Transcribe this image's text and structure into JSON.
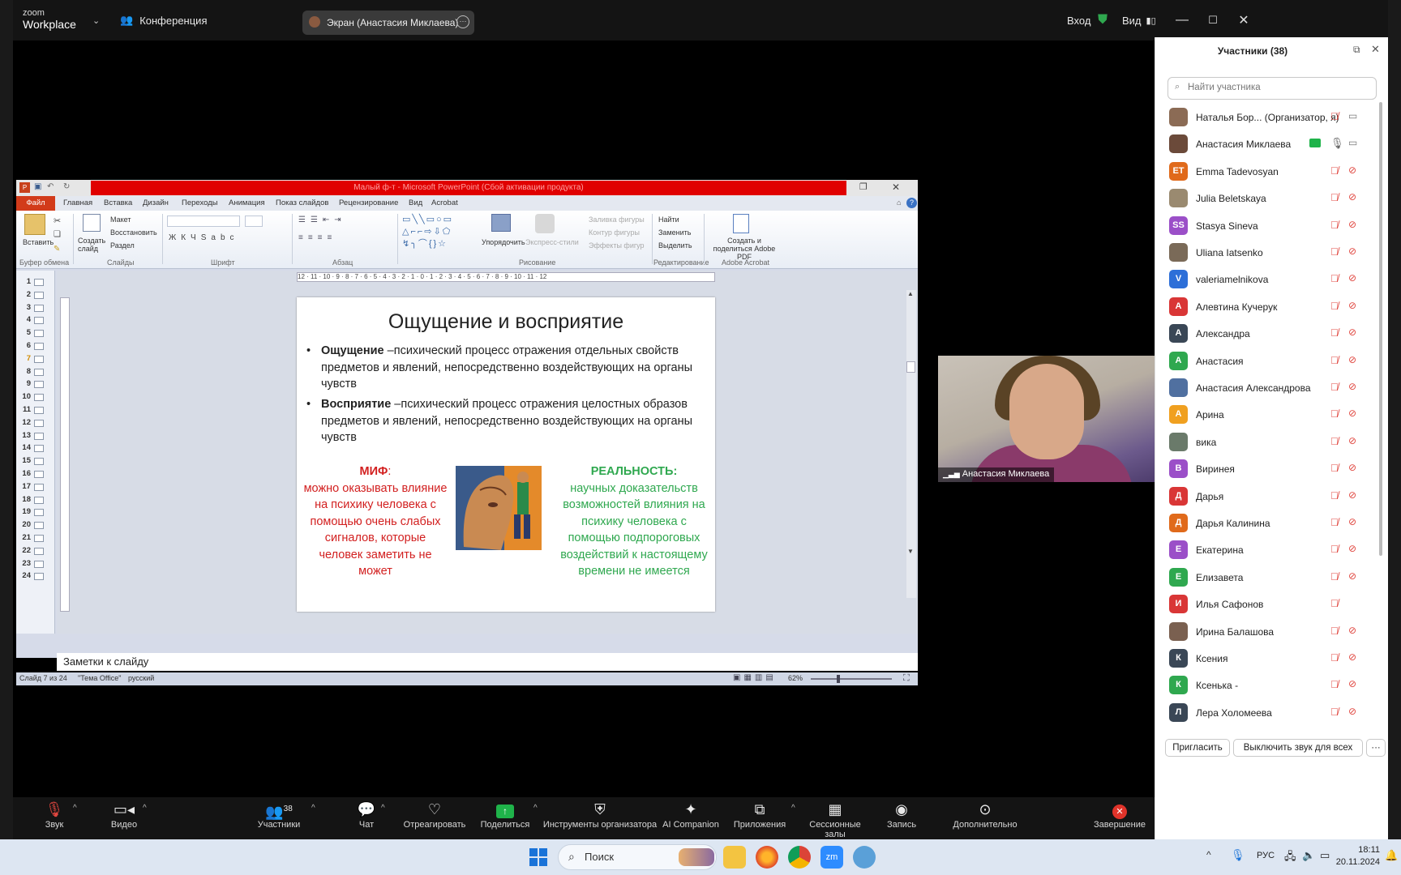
{
  "zoom": {
    "logo_line1": "zoom",
    "logo_line2": "Workplace",
    "conference_label": "Конференция",
    "share_label": "Экран (Анастасия Миклаева)",
    "signin": "Вход",
    "view": "Вид"
  },
  "ppt": {
    "window_title": "Малый ф-т - Microsoft PowerPoint (Сбой активации продукта)",
    "tabs": [
      "Файл",
      "Главная",
      "Вставка",
      "Дизайн",
      "Переходы",
      "Анимация",
      "Показ слайдов",
      "Рецензирование",
      "Вид",
      "Acrobat"
    ],
    "ribbon": {
      "paste": "Вставить",
      "new_slide": "Создать слайд",
      "layout": "Макет",
      "reset": "Восстановить",
      "section": "Раздел",
      "arrange": "Упорядочить",
      "quick_styles": "Экспресс-стили",
      "fill": "Заливка фигуры",
      "outline": "Контур фигуры",
      "effects": "Эффекты фигур",
      "find": "Найти",
      "replace": "Заменить",
      "select": "Выделить",
      "acrobat": "Создать и поделиться Adobe PDF",
      "groups": [
        "Буфер обмена",
        "Слайды",
        "Шрифт",
        "Абзац",
        "Рисование",
        "Редактирование",
        "Adobe Acrobat"
      ]
    },
    "ruler": "12 · 11 · 10 · 9 · 8 · 7 · 6 · 5 · 4 · 3 · 2 · 1 · 0 · 1 · 2 · 3 · 4 · 5 · 6 · 7 · 8 · 9 · 10 · 11 · 12",
    "slide_numbers": [
      "1",
      "2",
      "3",
      "4",
      "5",
      "6",
      "7",
      "8",
      "9",
      "10",
      "11",
      "12",
      "13",
      "14",
      "15",
      "16",
      "17",
      "18",
      "19",
      "20",
      "21",
      "22",
      "23",
      "24"
    ],
    "slide": {
      "title": "Ощущение и восприятие",
      "b1_term": "Ощущение",
      "b1_text": " –психический процесс отражения отдельных свойств предметов и явлений, непосредственно воздействующих на органы чувств",
      "b2_term": "Восприятие",
      "b2_text": " –психический процесс отражения целостных образов предметов и явлений, непосредственно воздействующих на органы чувств",
      "myth_head": "МИФ",
      "myth_colon": ":",
      "myth_text": "можно оказывать влияние на психику человека с помощью очень слабых сигналов, которые человек заметить не может",
      "real_head": "РЕАЛЬНОСТЬ:",
      "real_text": "научных доказательств возможностей влияния на психику человека с помощью подпороговых воздействий к настоящему времени не имеется"
    },
    "notes": "Заметки к слайду",
    "status": {
      "slide": "Слайд 7 из 24",
      "theme": "\"Тема Office\"",
      "lang": "русский",
      "zoom": "62%"
    }
  },
  "video": {
    "name": "Анастасия Миклаева"
  },
  "toolbar": {
    "audio": "Звук",
    "video": "Видео",
    "participants": "Участники",
    "participants_count": "38",
    "chat": "Чат",
    "react": "Отреагировать",
    "share": "Поделиться",
    "host_tools": "Инструменты организатора",
    "ai": "AI Companion",
    "apps": "Приложения",
    "breakout": "Сессионные залы",
    "record": "Запись",
    "more": "Дополнительно",
    "end": "Завершение"
  },
  "panel": {
    "title": "Участники (38)",
    "search_placeholder": "Найти участника",
    "invite": "Пригласить",
    "mute_all": "Выключить звук для всех",
    "participants": [
      {
        "name": "Наталья Бор... (Организатор, я)",
        "initials": "",
        "color": "#8b6b55"
      },
      {
        "name": "Анастасия Миклаева",
        "initials": "",
        "color": "#6b4a3a"
      },
      {
        "name": "Emma Tadevosyan",
        "initials": "ET",
        "color": "#e06a1b"
      },
      {
        "name": "Julia Beletskaya",
        "initials": "",
        "color": "#9a8a70"
      },
      {
        "name": "Stasya Sineva",
        "initials": "SS",
        "color": "#9b4fc8"
      },
      {
        "name": "Uliana Iatsenko",
        "initials": "",
        "color": "#7a6a58"
      },
      {
        "name": "valeriamelnikova",
        "initials": "V",
        "color": "#2d6fd8"
      },
      {
        "name": "Алевтина Кучерук",
        "initials": "А",
        "color": "#d93636"
      },
      {
        "name": "Александра",
        "initials": "А",
        "color": "#3a4756"
      },
      {
        "name": "Анастасия",
        "initials": "А",
        "color": "#2fa84f"
      },
      {
        "name": "Анастасия Александрова",
        "initials": "",
        "color": "#5070a0"
      },
      {
        "name": "Арина",
        "initials": "А",
        "color": "#f0a020"
      },
      {
        "name": "вика",
        "initials": "",
        "color": "#6a7a6a"
      },
      {
        "name": "Виринея",
        "initials": "В",
        "color": "#9b4fc8"
      },
      {
        "name": "Дарья",
        "initials": "Д",
        "color": "#d93636"
      },
      {
        "name": "Дарья Калинина",
        "initials": "Д",
        "color": "#e06a1b"
      },
      {
        "name": "Екатерина",
        "initials": "Е",
        "color": "#9b4fc8"
      },
      {
        "name": "Елизавета",
        "initials": "Е",
        "color": "#2fa84f"
      },
      {
        "name": "Илья Сафонов",
        "initials": "И",
        "color": "#d93636"
      },
      {
        "name": "Ирина Балашова",
        "initials": "",
        "color": "#7a6050"
      },
      {
        "name": "Ксения",
        "initials": "К",
        "color": "#3a4756"
      },
      {
        "name": "Ксенька -",
        "initials": "К",
        "color": "#2fa84f"
      },
      {
        "name": "Лера Холомеева",
        "initials": "Л",
        "color": "#3a4756"
      }
    ]
  },
  "taskbar": {
    "search": "Поиск",
    "lang": "РУС",
    "time": "18:11",
    "date": "20.11.2024"
  }
}
